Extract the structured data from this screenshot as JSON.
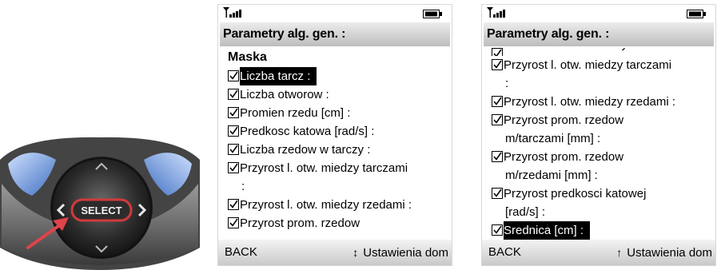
{
  "keypad": {
    "select_label": "SELECT",
    "colors": {
      "ring": "#2a2a2a",
      "accent_blue": "#5b8fd6",
      "pointer": "#e0434b",
      "select_outline": "#d23a3a"
    },
    "icons": [
      "up-arrow-icon",
      "down-arrow-icon",
      "left-arrow-icon",
      "right-arrow-icon"
    ]
  },
  "screen1": {
    "title": "Parametry alg. gen. :",
    "heading": "Maska",
    "rows": [
      {
        "text": "Liczba tarcz :",
        "checked": true,
        "selected": true
      },
      {
        "text": "Liczba otworow :",
        "checked": true
      },
      {
        "text": "Promien rzedu [cm] :",
        "checked": true
      },
      {
        "text": "Predkosc katowa [rad/s] :",
        "checked": true
      },
      {
        "text": "Liczba rzedow w tarczy :",
        "checked": true
      },
      {
        "text": "Przyrost l. otw. miedzy tarczami",
        "checked": true
      },
      {
        "text": ":",
        "continuation": true
      },
      {
        "text": "Przyrost l. otw. miedzy rzedami :",
        "checked": true
      },
      {
        "text": "Przyrost prom. rzedow",
        "checked": true
      }
    ],
    "softkeys": {
      "left": "BACK",
      "right": "Ustawienia dom",
      "nav_icon": "up-down-arrow-icon"
    }
  },
  "screen2": {
    "title": "Parametry alg. gen. :",
    "rows": [
      {
        "text": "Liczba rzedow w tarczy :",
        "checked": true,
        "cut": true
      },
      {
        "text": "Przyrost l. otw. miedzy tarczami",
        "checked": true
      },
      {
        "text": ":",
        "continuation": true
      },
      {
        "text": "Przyrost l. otw. miedzy rzedami :",
        "checked": true
      },
      {
        "text": "Przyrost prom. rzedow",
        "checked": true
      },
      {
        "text": "m/tarczami [mm] :",
        "continuation": true
      },
      {
        "text": "Przyrost prom. rzedow",
        "checked": true
      },
      {
        "text": "m/rzedami [mm] :",
        "continuation": true
      },
      {
        "text": "Przyrost predkosci katowej",
        "checked": true
      },
      {
        "text": "[rad/s] :",
        "continuation": true
      },
      {
        "text": "Srednica [cm] :",
        "checked": true,
        "selected": true
      }
    ],
    "softkeys": {
      "left": "BACK",
      "right": "Ustawienia dom",
      "nav_icon": "up-arrow-icon"
    }
  }
}
